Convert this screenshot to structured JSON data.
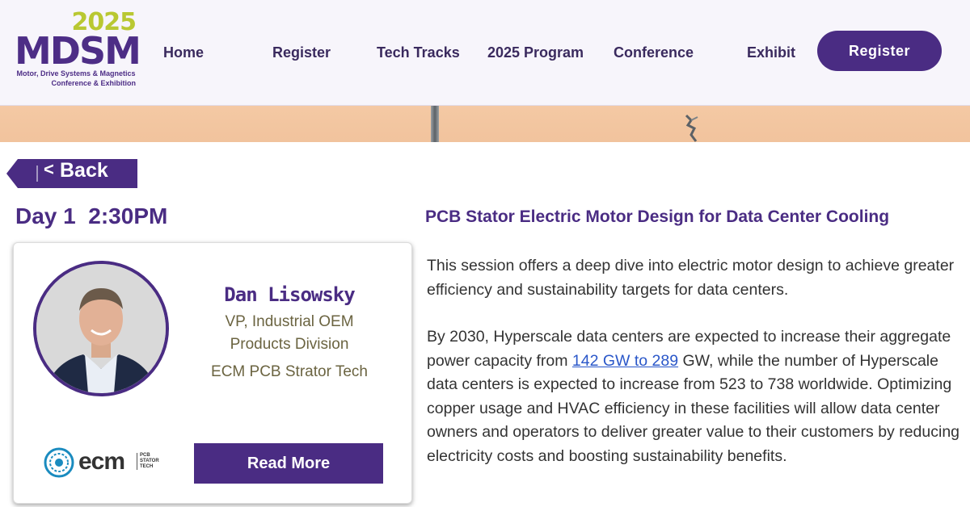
{
  "logo": {
    "year": "2025",
    "name": "MDSM",
    "subtitle_line1": "Motor, Drive Systems & Magnetics",
    "subtitle_line2": "Conference & Exhibition"
  },
  "nav": {
    "items": [
      {
        "label": "Home"
      },
      {
        "label": "Register"
      },
      {
        "label": "Tech Tracks"
      },
      {
        "label": "2025 Program"
      },
      {
        "label": "Conference"
      },
      {
        "label": "Exhibit"
      }
    ],
    "register_button": "Register"
  },
  "back_button": {
    "label": "Back",
    "chevron": "<"
  },
  "session": {
    "time": "Day 1  2:30PM",
    "title": "PCB Stator Electric Motor Design for Data Center Cooling",
    "paragraph1": "This session offers a deep dive into electric motor design to achieve greater efficiency and sustainability targets for data centers.",
    "paragraph2_before": "By 2030, Hyperscale data centers are expected to increase their aggregate power capacity from ",
    "paragraph2_link": "142 GW to 289",
    "paragraph2_after": " GW, while the number of Hyperscale data centers is expected to increase from 523 to 738 worldwide.  Optimizing copper usage and HVAC efficiency in these facilities will allow data center owners and operators to deliver greater value to their customers by reducing electricity costs and boosting sustainability benefits."
  },
  "speaker": {
    "name": "Dan Lisowsky",
    "title": "VP, Industrial OEM Products Division",
    "company": "ECM PCB Strator Tech",
    "logo_text": "ecm",
    "logo_sub": [
      "PCB",
      "STATOR",
      "TECH"
    ],
    "read_more": "Read More"
  },
  "colors": {
    "brand_purple": "#4a2c83",
    "brand_green": "#b9c832",
    "header_bg": "#f7f5fb",
    "link_blue": "#2a57c9",
    "speaker_text": "#6b6441"
  },
  "icons": {
    "back": "chevron-left-icon",
    "company_logo": "ecm-logo-icon"
  }
}
